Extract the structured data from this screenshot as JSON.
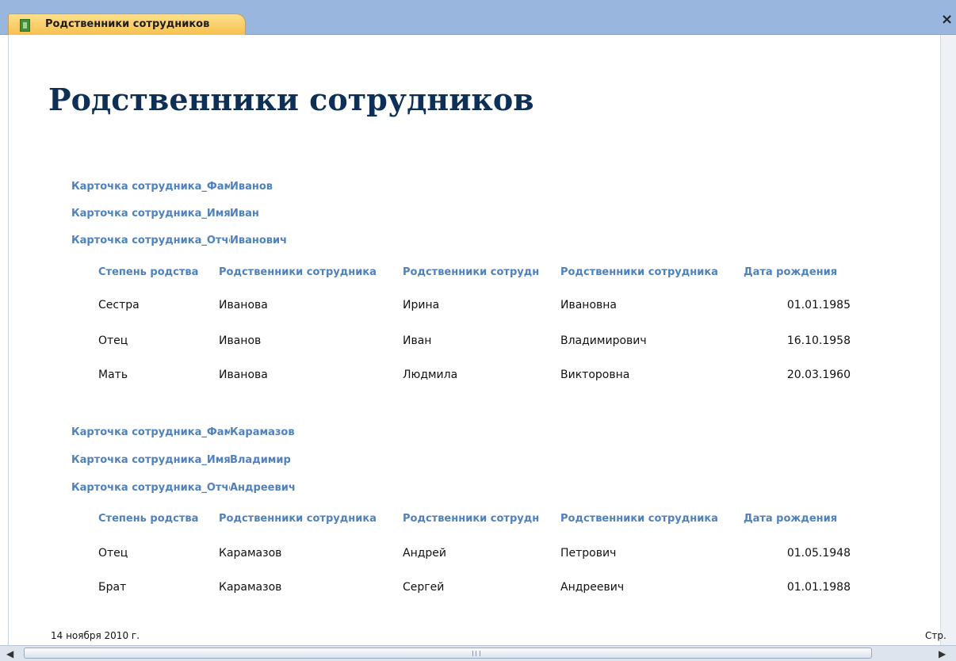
{
  "tab": {
    "title": "Родственники сотрудников",
    "icon": "report-icon",
    "close_label": "×"
  },
  "report": {
    "title": "Родственники сотрудников",
    "column_headers": [
      "Степень родства",
      "Родственники сотрудника",
      "Родственники сотрудн",
      "Родственники сотрудника",
      "Дата рождения"
    ],
    "groups": [
      {
        "fields": [
          {
            "label": "Карточка сотрудника_Фамилия",
            "value": "Иванов"
          },
          {
            "label": "Карточка сотрудника_Имя",
            "value": "Иван"
          },
          {
            "label": "Карточка сотрудника_Отчество",
            "value": "Иванович"
          }
        ],
        "rows": [
          [
            "Сестра",
            "Иванова",
            "Ирина",
            "Ивановна",
            "01.01.1985"
          ],
          [
            "Отец",
            "Иванов",
            "Иван",
            "Владимирович",
            "16.10.1958"
          ],
          [
            "Мать",
            "Иванова",
            "Людмила",
            "Викторовна",
            "20.03.1960"
          ]
        ]
      },
      {
        "fields": [
          {
            "label": "Карточка сотрудника_Фамилия",
            "value": "Карамазов"
          },
          {
            "label": "Карточка сотрудника_Имя",
            "value": "Владимир"
          },
          {
            "label": "Карточка сотрудника_Отчество",
            "value": "Андреевич"
          }
        ],
        "rows": [
          [
            "Отец",
            "Карамазов",
            "Андрей",
            "Петрович",
            "01.05.1948"
          ],
          [
            "Брат",
            "Карамазов",
            "Сергей",
            "Андреевич",
            "01.01.1988"
          ]
        ]
      }
    ]
  },
  "footer": {
    "date": "14 ноября 2010 г.",
    "page": "Стр."
  },
  "colors": {
    "header_blue": "#4f81bd",
    "title_navy": "#0e2f56",
    "tab_gold": "#f7c04f",
    "tabbar_blue": "#99b6df"
  }
}
